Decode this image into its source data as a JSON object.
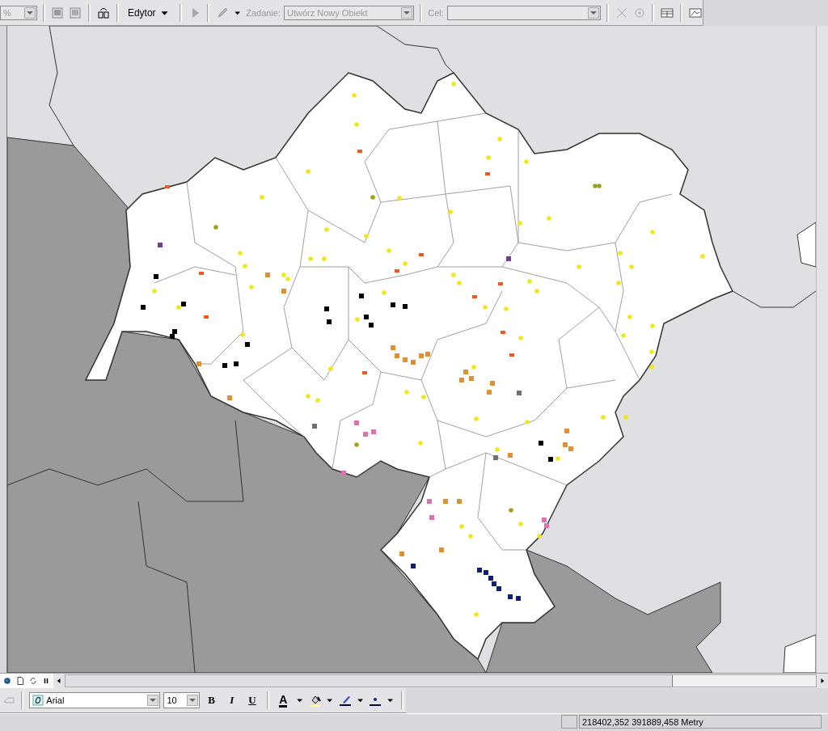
{
  "toolbar": {
    "scale_combo": {
      "value": "%"
    },
    "editor_menu": {
      "label": "Edytor"
    },
    "task": {
      "label": "Zadanie:",
      "value": "Utwórz Nowy Obiekt",
      "disabled": true
    },
    "target": {
      "label": "Cel:",
      "disabled": true
    }
  },
  "drawing_toolbar": {
    "font": {
      "value": "Arial"
    },
    "size": {
      "value": "10"
    },
    "styles": [
      {
        "label": "B",
        "kind": "bold"
      },
      {
        "label": "I",
        "kind": "italic"
      },
      {
        "label": "U",
        "kind": "underline"
      }
    ],
    "font_color": {
      "label": "A"
    }
  },
  "status_bar": {
    "coordinates": "218402,352  391889,458 Metry"
  }
}
